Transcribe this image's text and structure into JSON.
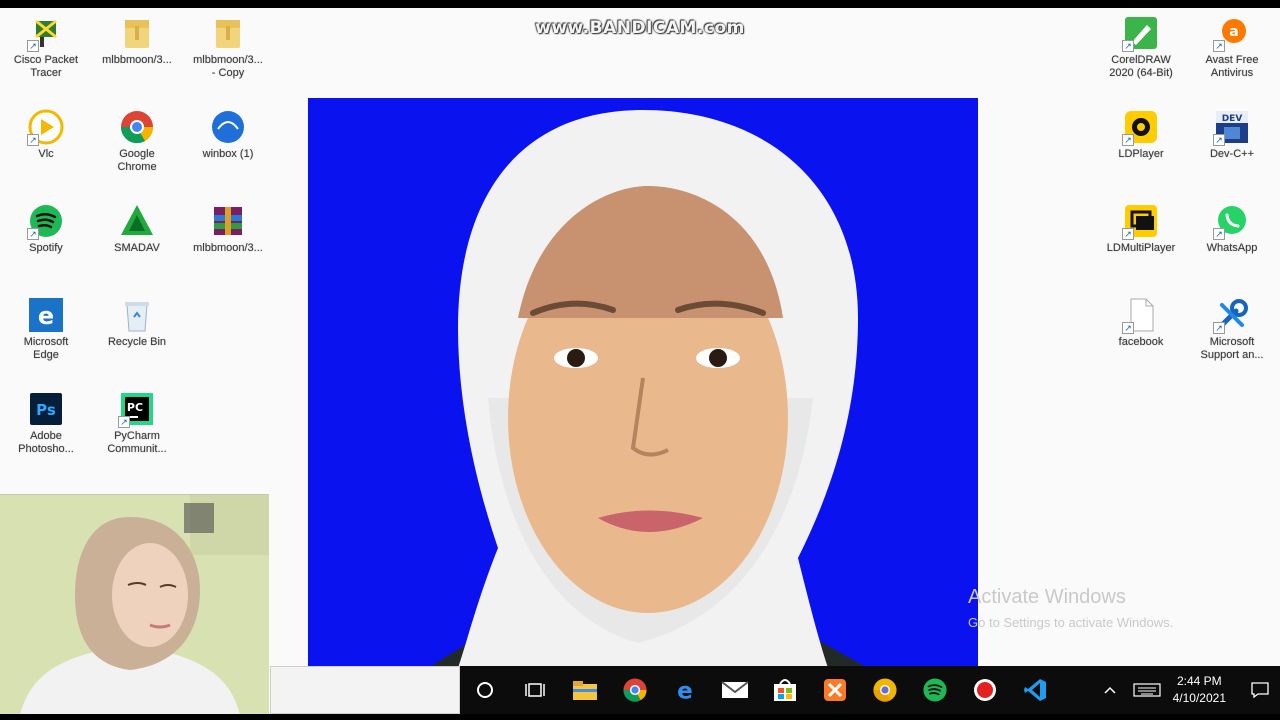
{
  "recording": {
    "watermark": "www.BANDICAM.com"
  },
  "desktop": {
    "left_icons": [
      {
        "label": "Cisco Packet\nTracer",
        "icon": "cisco-packet-tracer-icon"
      },
      {
        "label": "mlbbmoon/3...",
        "icon": "folder-icon"
      },
      {
        "label": "mlbbmoon/3...\n- Copy",
        "icon": "folder-icon"
      },
      {
        "label": "Vlc",
        "icon": "vlc-icon"
      },
      {
        "label": "Google\nChrome",
        "icon": "chrome-icon"
      },
      {
        "label": "winbox (1)",
        "icon": "winbox-icon"
      },
      {
        "label": "Spotify",
        "icon": "spotify-icon"
      },
      {
        "label": "SMADAV",
        "icon": "smadav-icon"
      },
      {
        "label": "mlbbmoon/3...",
        "icon": "winrar-icon"
      },
      {
        "label": "Microsoft\nEdge",
        "icon": "edge-icon"
      },
      {
        "label": "Recycle Bin",
        "icon": "recycle-bin-icon"
      },
      {
        "label": "Adobe\nPhotosho...",
        "icon": "photoshop-icon"
      },
      {
        "label": "PyCharm\nCommunit...",
        "icon": "pycharm-icon"
      }
    ],
    "right_icons": [
      {
        "label": "CorelDRAW\n2020 (64-Bit)",
        "icon": "coreldraw-icon"
      },
      {
        "label": "Avast Free\nAntivirus",
        "icon": "avast-icon"
      },
      {
        "label": "LDPlayer",
        "icon": "ldplayer-icon"
      },
      {
        "label": "Dev-C++",
        "icon": "devcpp-icon"
      },
      {
        "label": "LDMultiPlayer",
        "icon": "ldmultiplayer-icon"
      },
      {
        "label": "WhatsApp",
        "icon": "whatsapp-icon"
      },
      {
        "label": "facebook",
        "icon": "file-icon"
      },
      {
        "label": "Microsoft\nSupport an...",
        "icon": "microsoft-support-icon"
      }
    ],
    "icon_badges": {
      "photoshop": "Ps",
      "pycharm": "PC",
      "devcpp": "DEV"
    },
    "activate": {
      "title": "Activate Windows",
      "subtitle": "Go to Settings to activate Windows."
    }
  },
  "taskbar": {
    "time": "2:44 PM",
    "date": "4/10/2021",
    "buttons": [
      "cortana-icon",
      "task-view-icon",
      "file-explorer-icon",
      "chrome-icon",
      "edge-icon",
      "mail-icon",
      "store-icon",
      "xampp-icon",
      "chrome-canary-icon",
      "spotify-icon",
      "bandicam-record-icon",
      "vscode-icon"
    ]
  },
  "colors": {
    "photo_background": "#0a12f0",
    "taskbar": "#0c0c0c",
    "desktop": "#fafafa"
  }
}
